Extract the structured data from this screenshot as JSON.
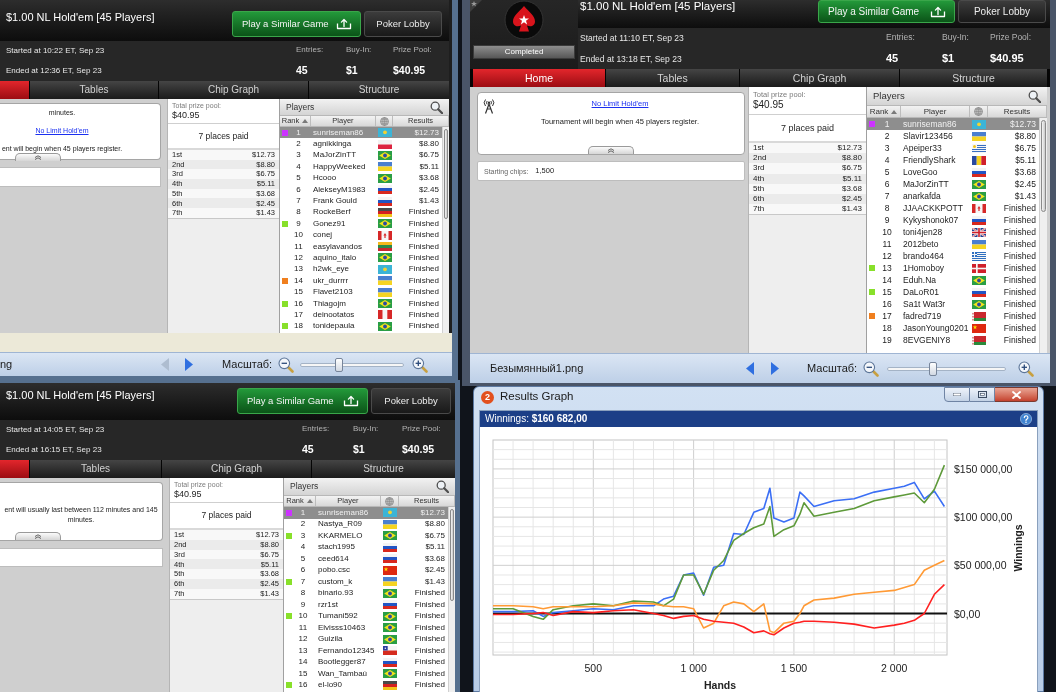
{
  "viewer_left": {
    "lobby": {
      "title": "$1.00 NL Hold'em [45 Players]",
      "buttons": [
        {
          "kind": "primary",
          "label": "Play a Similar Game"
        },
        {
          "kind": "secondary",
          "label": "Poker Lobby"
        }
      ],
      "started": "Started at 10:22 ET, Sep 23",
      "ended": "Ended at 12:36 ET, Sep 23",
      "stats": [
        {
          "label": "Entries:",
          "value": "45"
        },
        {
          "label": "Buy-In:",
          "value": "$1"
        },
        {
          "label": "Prize Pool:",
          "value": "$40.95"
        }
      ],
      "tabs": [
        {
          "selected": true
        },
        {
          "label": "Tables",
          "selected": false
        },
        {
          "label": "Chip Graph",
          "selected": false
        },
        {
          "label": "Structure",
          "selected": false
        }
      ],
      "info": [
        {
          "kind": "text",
          "text": "minutes."
        },
        {
          "kind": "link",
          "text": "No Limit Hold'em"
        },
        {
          "kind": "text",
          "text": "ent will begin when 45 players register."
        }
      ],
      "prize": {
        "label": "Total prize pool:",
        "total": "$40.95",
        "places": "7 places paid",
        "rows": [
          {
            "place": "1st",
            "amount": "$12.73"
          },
          {
            "place": "2nd",
            "amount": "$8.80"
          },
          {
            "place": "3rd",
            "amount": "$6.75"
          },
          {
            "place": "4th",
            "amount": "$5.11"
          },
          {
            "place": "5th",
            "amount": "$3.68"
          },
          {
            "place": "6th",
            "amount": "$2.45"
          },
          {
            "place": "7th",
            "amount": "$1.43"
          }
        ]
      },
      "players": {
        "title": "Players",
        "columns": [
          {
            "kind": "text",
            "label": "Rank",
            "sorted": true
          },
          {
            "kind": "text",
            "label": "Player",
            "sorted": false
          },
          {
            "kind": "globe",
            "sorted": false
          },
          {
            "kind": "text",
            "label": "Results",
            "sorted": false
          }
        ],
        "rows": [
          {
            "rank": "1",
            "player": "sunriseman86",
            "flag": {
              "kind": "kz"
            },
            "result": "$12.73",
            "selected": true,
            "color": "#cc33ff"
          },
          {
            "rank": "2",
            "player": "agnikkinga",
            "flag": {
              "kind": "pl"
            },
            "result": "$8.80",
            "selected": false
          },
          {
            "rank": "3",
            "player": "MaJorZinTT",
            "flag": {
              "kind": "br"
            },
            "result": "$6.75",
            "selected": false
          },
          {
            "rank": "4",
            "player": "HappyWeeked",
            "flag": {
              "kind": "ua"
            },
            "result": "$5.11",
            "selected": false
          },
          {
            "rank": "5",
            "player": "Hcooo",
            "flag": {
              "kind": "br"
            },
            "result": "$3.68",
            "selected": false
          },
          {
            "rank": "6",
            "player": "AlekseyM1983",
            "flag": {
              "kind": "ru"
            },
            "result": "$2.45",
            "selected": false
          },
          {
            "rank": "7",
            "player": "Frank Gould",
            "flag": {
              "kind": "ru"
            },
            "result": "$1.43",
            "selected": false
          },
          {
            "rank": "8",
            "player": "RockeBerf",
            "flag": {
              "kind": "de"
            },
            "result": "Finished",
            "selected": false
          },
          {
            "rank": "9",
            "player": "Gonez91",
            "flag": {
              "kind": "br"
            },
            "result": "Finished",
            "selected": false,
            "color": "#88e02a"
          },
          {
            "rank": "10",
            "player": "conej",
            "flag": {
              "kind": "ca"
            },
            "result": "Finished",
            "selected": false
          },
          {
            "rank": "11",
            "player": "easylavandos",
            "flag": {
              "kind": "lt"
            },
            "result": "Finished",
            "selected": false
          },
          {
            "rank": "12",
            "player": "aquino_italo",
            "flag": {
              "kind": "br"
            },
            "result": "Finished",
            "selected": false
          },
          {
            "rank": "13",
            "player": "h2wk_eye",
            "flag": {
              "kind": "kz"
            },
            "result": "Finished",
            "selected": false
          },
          {
            "rank": "14",
            "player": "ukr_durrrr",
            "flag": {
              "kind": "ua"
            },
            "result": "Finished",
            "selected": false,
            "color": "#f07f1e"
          },
          {
            "rank": "15",
            "player": "Flavet2103",
            "flag": {
              "kind": "ua"
            },
            "result": "Finished",
            "selected": false
          },
          {
            "rank": "16",
            "player": "Thiagojm",
            "flag": {
              "kind": "br"
            },
            "result": "Finished",
            "selected": false,
            "color": "#88e02a"
          },
          {
            "rank": "17",
            "player": "deinootatos",
            "flag": {
              "kind": "pe"
            },
            "result": "Finished",
            "selected": false
          },
          {
            "rank": "18",
            "player": "tonidepaula",
            "flag": {
              "kind": "br"
            },
            "result": "Finished",
            "selected": false,
            "color": "#88e02a"
          }
        ]
      }
    },
    "toolbar": {
      "file_name": "ng",
      "prev": {
        "disabled": true
      },
      "next": {
        "disabled": false
      },
      "zoom_label": "Масштаб:",
      "zoom": {
        "level": 0.36
      }
    }
  },
  "viewer_right": {
    "lobby": {
      "title": "$1.00 NL Hold'em [45 Players]",
      "buttons": [
        {
          "kind": "primary",
          "label": "Play a Similar Game"
        },
        {
          "kind": "secondary",
          "label": "Poker Lobby"
        }
      ],
      "status": "Completed",
      "started": "Started at 11:10 ET, Sep 23",
      "ended": "Ended at 13:18 ET, Sep 23",
      "stats": [
        {
          "label": "Entries:",
          "value": "45"
        },
        {
          "label": "Buy-In:",
          "value": "$1"
        },
        {
          "label": "Prize Pool:",
          "value": "$40.95"
        }
      ],
      "tabs": [
        {
          "label": "Home",
          "selected": true
        },
        {
          "label": "Tables",
          "selected": false
        },
        {
          "label": "Chip Graph",
          "selected": false
        },
        {
          "label": "Structure",
          "selected": false
        }
      ],
      "info": [
        {
          "kind": "link",
          "text": "No Limit Hold'em"
        },
        {
          "kind": "text",
          "text": "Tournament will begin when 45 players register."
        }
      ],
      "starting_chips": {
        "label": "Starting chips:",
        "value": "1,500"
      },
      "prize": {
        "label": "Total prize pool:",
        "total": "$40.95",
        "places": "7 places paid",
        "rows": [
          {
            "place": "1st",
            "amount": "$12.73"
          },
          {
            "place": "2nd",
            "amount": "$8.80"
          },
          {
            "place": "3rd",
            "amount": "$6.75"
          },
          {
            "place": "4th",
            "amount": "$5.11"
          },
          {
            "place": "5th",
            "amount": "$3.68"
          },
          {
            "place": "6th",
            "amount": "$2.45"
          },
          {
            "place": "7th",
            "amount": "$1.43"
          }
        ]
      },
      "players": {
        "title": "Players",
        "columns": [
          {
            "kind": "text",
            "label": "Rank",
            "sorted": true
          },
          {
            "kind": "text",
            "label": "Player",
            "sorted": false
          },
          {
            "kind": "globe",
            "sorted": false
          },
          {
            "kind": "text",
            "label": "Results",
            "sorted": false
          }
        ],
        "rows": [
          {
            "rank": "1",
            "player": "sunriseman86",
            "flag": {
              "kind": "kz"
            },
            "result": "$12.73",
            "selected": true,
            "color": "#cc33ff"
          },
          {
            "rank": "2",
            "player": "Slavir123456",
            "flag": {
              "kind": "ua"
            },
            "result": "$8.80",
            "selected": false
          },
          {
            "rank": "3",
            "player": "Apeiper33",
            "flag": {
              "kind": "uy"
            },
            "result": "$6.75",
            "selected": false
          },
          {
            "rank": "4",
            "player": "FriendlyShark",
            "flag": {
              "kind": "ro"
            },
            "result": "$5.11",
            "selected": false
          },
          {
            "rank": "5",
            "player": "LoveGoo",
            "flag": {
              "kind": "ru"
            },
            "result": "$3.68",
            "selected": false
          },
          {
            "rank": "6",
            "player": "MaJorZinTT",
            "flag": {
              "kind": "br"
            },
            "result": "$2.45",
            "selected": false
          },
          {
            "rank": "7",
            "player": "anarkafda",
            "flag": {
              "kind": "br"
            },
            "result": "$1.43",
            "selected": false
          },
          {
            "rank": "8",
            "player": "JJAACKKPOTT",
            "flag": {
              "kind": "ca"
            },
            "result": "Finished",
            "selected": false
          },
          {
            "rank": "9",
            "player": "Kykyshonok07",
            "flag": {
              "kind": "ru"
            },
            "result": "Finished",
            "selected": false
          },
          {
            "rank": "10",
            "player": "toni4jen28",
            "flag": {
              "kind": "gb"
            },
            "result": "Finished",
            "selected": false
          },
          {
            "rank": "11",
            "player": "2012beto",
            "flag": {
              "kind": "ua"
            },
            "result": "Finished",
            "selected": false
          },
          {
            "rank": "12",
            "player": "brando464",
            "flag": {
              "kind": "gr"
            },
            "result": "Finished",
            "selected": false
          },
          {
            "rank": "13",
            "player": "1Homoboy",
            "flag": {
              "kind": "dk"
            },
            "result": "Finished",
            "selected": false,
            "color": "#88e02a"
          },
          {
            "rank": "14",
            "player": "Eduh.Na",
            "flag": {
              "kind": "br"
            },
            "result": "Finished",
            "selected": false
          },
          {
            "rank": "15",
            "player": "DaLoR01",
            "flag": {
              "kind": "ru"
            },
            "result": "Finished",
            "selected": false,
            "color": "#88e02a"
          },
          {
            "rank": "16",
            "player": "Sa1t Wat3r",
            "flag": {
              "kind": "br"
            },
            "result": "Finished",
            "selected": false
          },
          {
            "rank": "17",
            "player": "fadred719",
            "flag": {
              "kind": "by"
            },
            "result": "Finished",
            "selected": false,
            "color": "#f07f1e"
          },
          {
            "rank": "18",
            "player": "JasonYoung0201",
            "flag": {
              "kind": "cn"
            },
            "result": "Finished",
            "selected": false
          },
          {
            "rank": "19",
            "player": "8EVGENIY8",
            "flag": {
              "kind": "by"
            },
            "result": "Finished",
            "selected": false
          }
        ]
      }
    },
    "toolbar": {
      "file_name": "Безымянный1.png",
      "prev": {
        "disabled": false
      },
      "next": {
        "disabled": false
      },
      "zoom_label": "Масштаб:",
      "zoom": {
        "level": 0.38
      }
    }
  },
  "lobby_bottom": {
    "title": "$1.00 NL Hold'em [45 Players]",
    "buttons": [
      {
        "kind": "primary",
        "label": "Play a Similar Game"
      },
      {
        "kind": "secondary",
        "label": "Poker Lobby"
      }
    ],
    "started": "Started at 14:05 ET, Sep 23",
    "ended": "Ended at 16:15 ET, Sep 23",
    "stats": [
      {
        "label": "Entries:",
        "value": "45"
      },
      {
        "label": "Buy-In:",
        "value": "$1"
      },
      {
        "label": "Prize Pool:",
        "value": "$40.95"
      }
    ],
    "tabs": [
      {
        "selected": true
      },
      {
        "label": "Tables",
        "selected": false
      },
      {
        "label": "Chip Graph",
        "selected": false
      },
      {
        "label": "Structure",
        "selected": false
      }
    ],
    "info": [
      {
        "kind": "text",
        "text": "ent will usually last between 112 minutes and 145 minutes."
      }
    ],
    "prize": {
      "label": "Total prize pool:",
      "total": "$40.95",
      "places": "7 places paid",
      "rows": [
        {
          "place": "1st",
          "amount": "$12.73"
        },
        {
          "place": "2nd",
          "amount": "$8.80"
        },
        {
          "place": "3rd",
          "amount": "$6.75"
        },
        {
          "place": "4th",
          "amount": "$5.11"
        },
        {
          "place": "5th",
          "amount": "$3.68"
        },
        {
          "place": "6th",
          "amount": "$2.45"
        },
        {
          "place": "7th",
          "amount": "$1.43"
        }
      ]
    },
    "players": {
      "title": "Players",
      "columns": [
        {
          "kind": "text",
          "label": "Rank",
          "sorted": true
        },
        {
          "kind": "text",
          "label": "Player",
          "sorted": false
        },
        {
          "kind": "globe",
          "sorted": false
        },
        {
          "kind": "text",
          "label": "Results",
          "sorted": false
        }
      ],
      "rows": [
        {
          "rank": "1",
          "player": "sunriseman86",
          "flag": {
            "kind": "kz"
          },
          "result": "$12.73",
          "selected": true,
          "color": "#cc33ff"
        },
        {
          "rank": "2",
          "player": "Nastya_R09",
          "flag": {
            "kind": "ua"
          },
          "result": "$8.80",
          "selected": false
        },
        {
          "rank": "3",
          "player": "KKARMELO",
          "flag": {
            "kind": "br"
          },
          "result": "$6.75",
          "selected": false,
          "color": "#88e02a"
        },
        {
          "rank": "4",
          "player": "stach1995",
          "flag": {
            "kind": "ru"
          },
          "result": "$5.11",
          "selected": false
        },
        {
          "rank": "5",
          "player": "ceed614",
          "flag": {
            "kind": "ru"
          },
          "result": "$3.68",
          "selected": false
        },
        {
          "rank": "6",
          "player": "pobo.csc",
          "flag": {
            "kind": "cn"
          },
          "result": "$2.45",
          "selected": false
        },
        {
          "rank": "7",
          "player": "custom_k",
          "flag": {
            "kind": "ua"
          },
          "result": "$1.43",
          "selected": false,
          "color": "#88e02a"
        },
        {
          "rank": "8",
          "player": "binario.93",
          "flag": {
            "kind": "br"
          },
          "result": "Finished",
          "selected": false
        },
        {
          "rank": "9",
          "player": "rzr1st",
          "flag": {
            "kind": "ru"
          },
          "result": "Finished",
          "selected": false
        },
        {
          "rank": "10",
          "player": "Tumani592",
          "flag": {
            "kind": "br"
          },
          "result": "Finished",
          "selected": false,
          "color": "#88e02a"
        },
        {
          "rank": "11",
          "player": "Elvisss10463",
          "flag": {
            "kind": "br"
          },
          "result": "Finished",
          "selected": false
        },
        {
          "rank": "12",
          "player": "Guizila",
          "flag": {
            "kind": "br"
          },
          "result": "Finished",
          "selected": false
        },
        {
          "rank": "13",
          "player": "Fernando12345",
          "flag": {
            "kind": "cl"
          },
          "result": "Finished",
          "selected": false
        },
        {
          "rank": "14",
          "player": "Bootlegger87",
          "flag": {
            "kind": "ru"
          },
          "result": "Finished",
          "selected": false
        },
        {
          "rank": "15",
          "player": "Wan_Tambaú",
          "flag": {
            "kind": "br"
          },
          "result": "Finished",
          "selected": false
        },
        {
          "rank": "16",
          "player": "el-lo90",
          "flag": {
            "kind": "de"
          },
          "result": "Finished",
          "selected": false,
          "color": "#88e02a"
        }
      ]
    }
  },
  "results_graph": {
    "app_icon": "2",
    "title": "Results Graph",
    "summary": "Winnings: **$160 682,00**",
    "chart_data": {
      "type": "line",
      "xlabel": "Hands",
      "ylabel": "Winnings",
      "grid": true,
      "x": [
        0,
        100,
        200,
        250,
        300,
        400,
        500,
        600,
        700,
        800,
        850,
        900,
        950,
        1000,
        1050,
        1100,
        1150,
        1200,
        1250,
        1300,
        1350,
        1380,
        1400,
        1450,
        1500,
        1530,
        1550,
        1600,
        1700,
        1800,
        1900,
        2000,
        2050,
        2100,
        2150,
        2200,
        2250
      ],
      "series": [
        {
          "color": "#3b6ff5",
          "values": [
            2000,
            2000,
            3000,
            -3000,
            1000,
            3000,
            5000,
            4000,
            8000,
            8000,
            15000,
            18000,
            40000,
            42000,
            19000,
            48000,
            50000,
            83000,
            82000,
            105000,
            109000,
            130000,
            99000,
            95000,
            99000,
            126000,
            122000,
            111000,
            117000,
            119000,
            126000,
            130000,
            132000,
            136000,
            119000,
            127000,
            111000
          ]
        },
        {
          "color": "#5e9a3a",
          "values": [
            5000,
            5000,
            -3000,
            -6000,
            4000,
            8000,
            10000,
            8000,
            13000,
            12000,
            8000,
            15000,
            40000,
            40000,
            20000,
            45000,
            55000,
            76000,
            83000,
            89000,
            93000,
            111000,
            80000,
            87000,
            91000,
            103000,
            115000,
            101000,
            105000,
            109000,
            117000,
            121000,
            123000,
            125000,
            115000,
            129000,
            154000
          ]
        },
        {
          "color": "#ff9a35",
          "values": [
            8000,
            8000,
            7000,
            5000,
            7000,
            7000,
            7000,
            8000,
            11000,
            10000,
            8000,
            7000,
            7000,
            5000,
            -15000,
            -10000,
            8000,
            12000,
            10000,
            2000,
            10000,
            -18000,
            -20000,
            -10000,
            -8000,
            0,
            8000,
            14000,
            16000,
            20000,
            22000,
            24000,
            27000,
            30000,
            45000,
            50000,
            55000
          ]
        },
        {
          "color": "#ff2020",
          "values": [
            -1000,
            -1000,
            0,
            1000,
            -2000,
            2000,
            1000,
            3000,
            4000,
            0,
            -2000,
            -5000,
            -3000,
            -2000,
            -6000,
            -8000,
            -9000,
            -10000,
            -14000,
            -20000,
            -18000,
            -21000,
            -22000,
            -15000,
            -10000,
            -9000,
            -8000,
            -8000,
            -9000,
            -11000,
            -15000,
            -12000,
            -10000,
            -7000,
            0,
            20000,
            30000
          ]
        }
      ],
      "xlim": [
        0,
        2263
      ],
      "ylim": [
        -43000,
        180000
      ],
      "xticks": [
        {
          "value": 500,
          "label": "500"
        },
        {
          "value": 1000,
          "label": "1 000"
        },
        {
          "value": 1500,
          "label": "1 500"
        },
        {
          "value": 2000,
          "label": "2 000"
        }
      ],
      "yticks": [
        {
          "value": 0,
          "label": "$0,00"
        },
        {
          "value": 50000,
          "label": "$50 000,00"
        },
        {
          "value": 100000,
          "label": "$100 000,00"
        },
        {
          "value": 150000,
          "label": "$150 000,00"
        }
      ]
    }
  }
}
